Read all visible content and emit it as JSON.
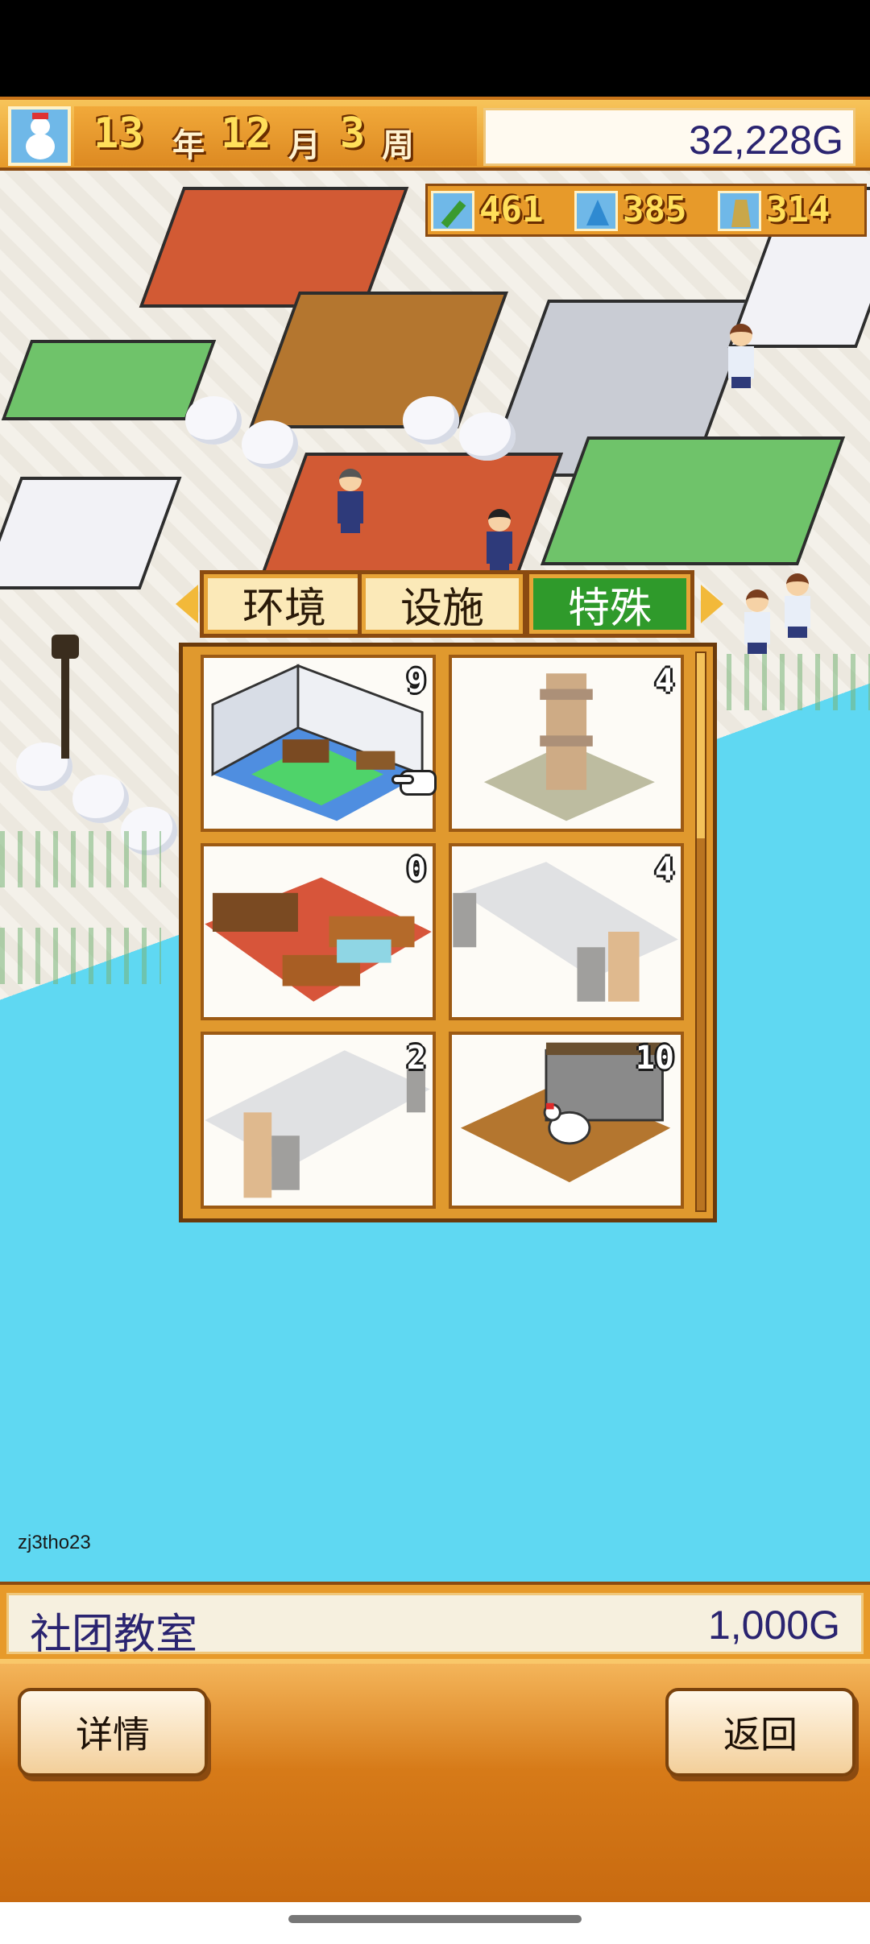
{
  "hud": {
    "year_num": "13",
    "year_unit": "年",
    "month_num": "12",
    "month_unit": "月",
    "week_num": "3",
    "week_unit": "周",
    "money": "32,228G",
    "season_icon": "snowman-icon"
  },
  "resources": [
    {
      "icon": "pencil-icon",
      "value": "461"
    },
    {
      "icon": "flask-icon",
      "value": "385"
    },
    {
      "icon": "trophy-icon",
      "value": "314"
    }
  ],
  "build_menu": {
    "tabs": [
      {
        "label": "环境",
        "active": false
      },
      {
        "label": "设施",
        "active": false
      },
      {
        "label": "特殊",
        "active": true
      }
    ],
    "items": [
      {
        "count": "9",
        "art": "club-room",
        "dim": false
      },
      {
        "count": "4",
        "art": "clock-tower",
        "dim": true
      },
      {
        "count": "0",
        "art": "office-room",
        "dim": false
      },
      {
        "count": "4",
        "art": "corridor-gate",
        "dim": true
      },
      {
        "count": "2",
        "art": "corridor-gate-left",
        "dim": true
      },
      {
        "count": "10",
        "art": "chicken-coop",
        "dim": false
      }
    ]
  },
  "watermark": "zj3tho23",
  "selection": {
    "name": "社团教室",
    "price": "1,000G"
  },
  "buttons": {
    "detail": "详情",
    "back": "返回"
  }
}
